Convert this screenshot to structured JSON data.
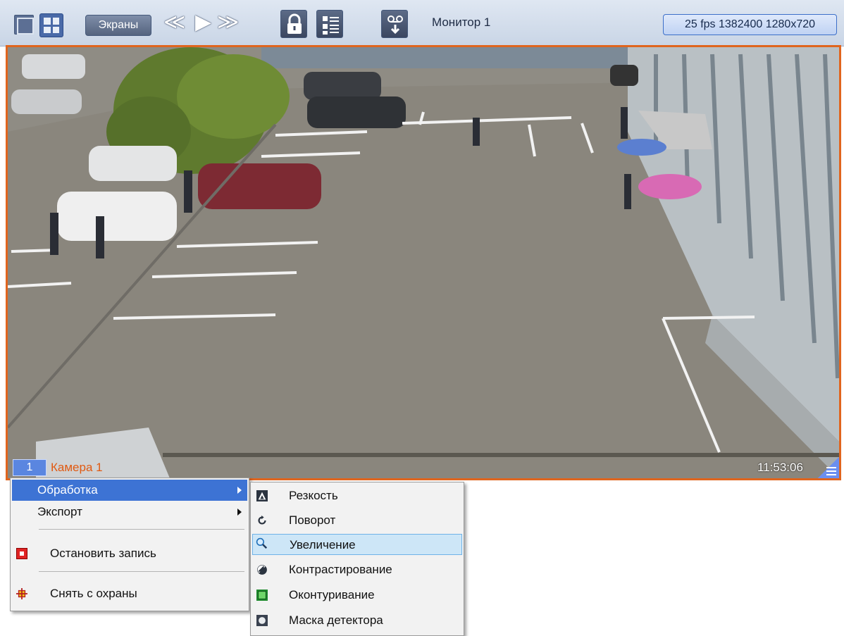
{
  "toolbar": {
    "screens_label": "Экраны",
    "nav_prev_glyph": "≪",
    "nav_play_glyph": "▶",
    "nav_next_glyph": "≫",
    "lock_glyph": "🔒",
    "list_glyph": "☰",
    "record_glyph": "⇩",
    "monitor_label": "Монитор 1",
    "stream_info": "25 fps 1382400 1280x720"
  },
  "camera": {
    "number": "1",
    "name": "Камера 1",
    "time": "11:53:06",
    "border_color": "#e0651e"
  },
  "context_menu": {
    "items": [
      {
        "label": "Обработка",
        "has_submenu": true,
        "highlighted": true
      },
      {
        "label": "Экспорт",
        "has_submenu": true
      },
      {
        "label": "Остановить запись",
        "icon": "stop-record-icon"
      },
      {
        "label": "Снять с охраны",
        "icon": "disarm-icon"
      }
    ]
  },
  "submenu": {
    "items": [
      {
        "label": "Резкость",
        "icon": "sharpness-icon"
      },
      {
        "label": "Поворот",
        "icon": "rotate-icon"
      },
      {
        "label": "Увеличение",
        "icon": "zoom-icon",
        "selected": true
      },
      {
        "label": "Контрастирование",
        "icon": "contrast-icon"
      },
      {
        "label": "Оконтуривание",
        "icon": "contour-icon"
      },
      {
        "label": "Маска детектора",
        "icon": "detector-mask-icon"
      }
    ]
  }
}
